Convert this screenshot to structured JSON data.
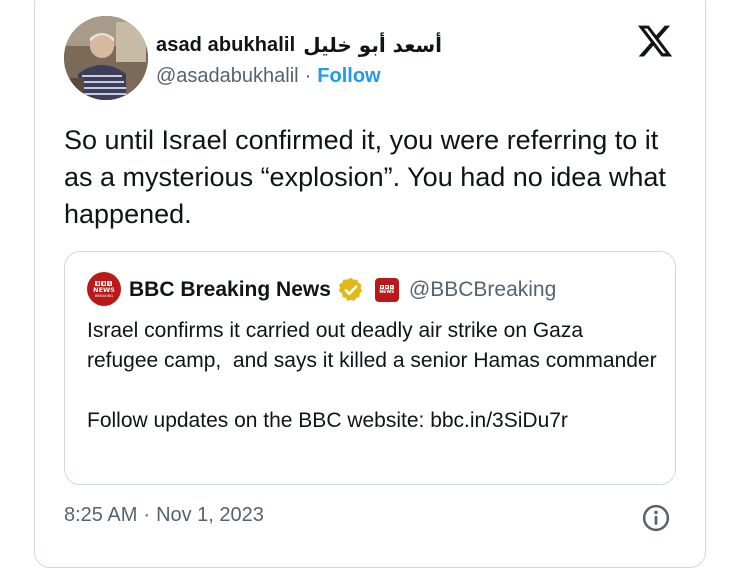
{
  "author": {
    "display_name": "asad abukhalil",
    "arabic_name": "أسعد أبو خليل",
    "handle": "@asadabukhalil",
    "separator": "·",
    "follow_label": "Follow"
  },
  "tweet": {
    "text": "So until Israel confirmed it, you were referring to it as a mysterious “explosion”. You had no idea what happened."
  },
  "quoted_tweet": {
    "avatar_label": "BBC NEWS",
    "display_name": "BBC Breaking News",
    "handle": "@BBCBreaking",
    "text": "Israel confirms it carried out deadly air strike on Gaza refugee camp,  and says it killed a senior Hamas commander\n\nFollow updates on the BBC website: bbc.in/3SiDu7r"
  },
  "meta": {
    "time": "8:25 AM",
    "separator": "·",
    "date": "Nov 1, 2023"
  },
  "icons": {
    "platform_logo": "x-logo-icon",
    "verified": "gold-verified-badge-icon",
    "affiliate": "bbc-news-affiliate-badge-icon",
    "info": "info-icon"
  },
  "colors": {
    "link_blue": "#1d9bf0",
    "muted_gray": "#536471",
    "border": "#cfd9de",
    "bbc_red": "#bb1919",
    "verified_gold": "#e2b719"
  }
}
